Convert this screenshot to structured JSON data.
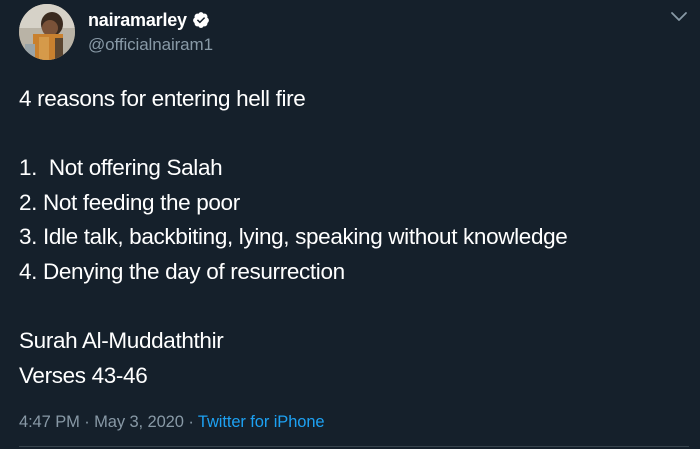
{
  "author": {
    "display_name": "nairamarley",
    "handle": "@officialnairam1",
    "verified": true
  },
  "icons": {
    "verified": "verified-badge-icon",
    "more": "chevron-down-icon",
    "avatar": "profile-photo"
  },
  "tweet": {
    "lines": [
      "4 reasons for entering hell fire",
      "",
      "1.  Not offering Salah",
      "2. Not feeding the poor",
      "3. Idle talk, backbiting, lying, speaking without knowledge",
      "4. Denying the day of resurrection",
      "",
      "Surah Al-Muddaththir",
      "Verses 43-46"
    ]
  },
  "meta": {
    "time": "4:47 PM",
    "separator": " · ",
    "date": "May 3, 2020",
    "source": "Twitter for iPhone"
  },
  "colors": {
    "background": "#15202b",
    "text_primary": "#ffffff",
    "text_secondary": "#8899a6",
    "accent": "#1da1f2",
    "divider": "#38444d"
  }
}
